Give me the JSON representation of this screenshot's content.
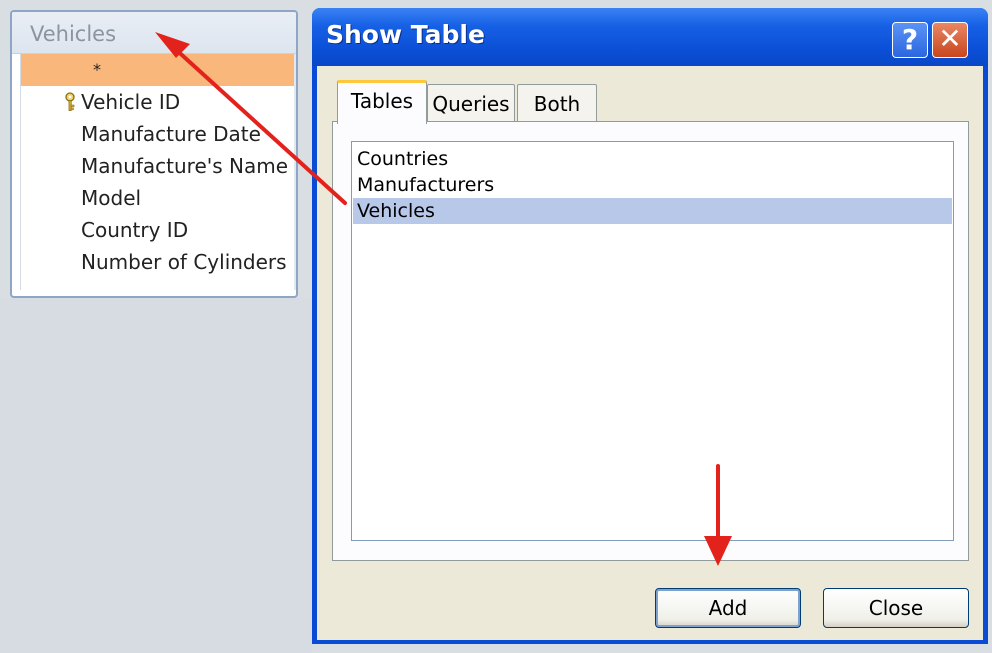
{
  "field_list": {
    "title": "Vehicles",
    "star": "*",
    "fields": [
      "Vehicle ID",
      "Manufacture Date",
      "Manufacture's Name",
      "Model",
      "Country ID",
      "Number of Cylinders"
    ],
    "primary_key_icon": "key-icon"
  },
  "dialog": {
    "title": "Show Table",
    "help_label": "?",
    "close_label": "✕",
    "tabs": [
      "Tables",
      "Queries",
      "Both"
    ],
    "active_tab": "Tables",
    "list_items": [
      "Countries",
      "Manufacturers",
      "Vehicles"
    ],
    "selected_item": "Vehicles",
    "add_label": "Add",
    "close_button_label": "Close"
  },
  "colors": {
    "title_bar": "#1761e6",
    "selection": "#b7c8e8",
    "star_row": "#f9b77b",
    "annotation_arrow": "#e3221b"
  }
}
